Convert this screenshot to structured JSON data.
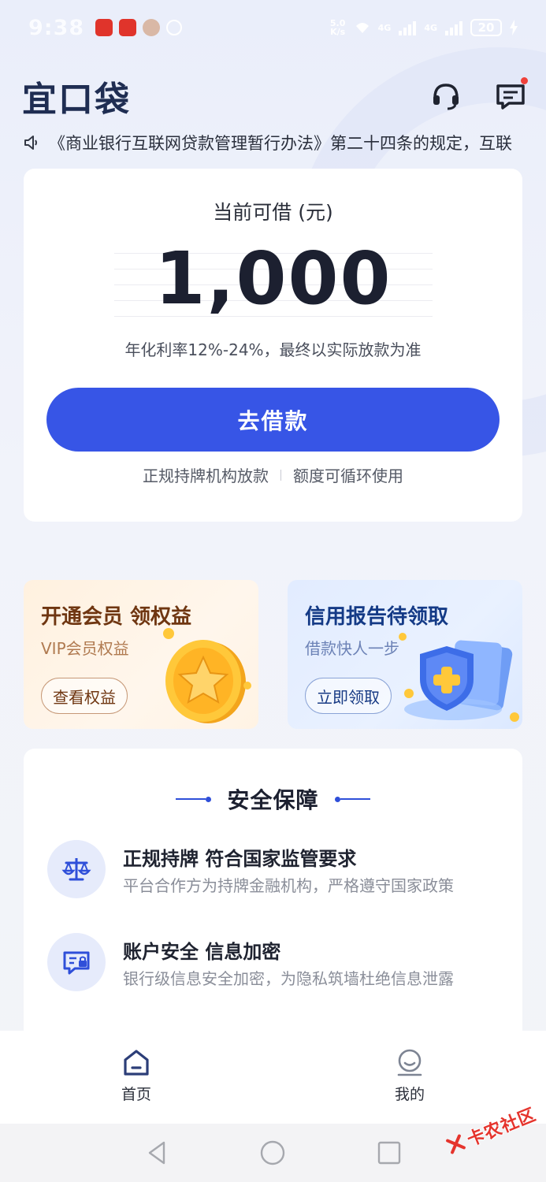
{
  "status_bar": {
    "time": "9:38",
    "network_speed": "5.0\nK/s",
    "signal_1": "4G",
    "signal_2": "4G",
    "battery": "20"
  },
  "header": {
    "logo": "宜口袋",
    "support_icon": "headset-icon",
    "message_icon": "message-icon"
  },
  "notice": {
    "icon": "speaker-icon",
    "text": "《商业银行互联网贷款管理暂行办法》第二十四条的规定，互联"
  },
  "loan_card": {
    "label": "当前可借 (元)",
    "amount": "1,000",
    "rate_text": "年化利率12%-24%，最终以实际放款为准",
    "button": "去借款",
    "feature_1": "正规持牌机构放款",
    "feature_2": "额度可循环使用"
  },
  "promos": [
    {
      "title": "开通会员 领权益",
      "subtitle": "VIP会员权益",
      "button": "查看权益",
      "art": "gold-star-coin-icon"
    },
    {
      "title": "信用报告待领取",
      "subtitle": "借款快人一步",
      "button": "立即领取",
      "art": "shield-report-icon"
    }
  ],
  "security": {
    "title": "安全保障",
    "items": [
      {
        "icon": "scale-icon",
        "title": "正规持牌 符合国家监管要求",
        "desc": "平台合作方为持牌金融机构，严格遵守国家政策"
      },
      {
        "icon": "secure-card-icon",
        "title": "账户安全 信息加密",
        "desc": "银行级信息安全加密，为隐私筑墙杜绝信息泄露"
      }
    ]
  },
  "bottom_nav": {
    "home": "首页",
    "mine": "我的"
  },
  "watermark": "卡农社区",
  "colors": {
    "primary": "#3755e6",
    "logo": "#1f2d52",
    "vip_title": "#6f3611",
    "credit_title": "#143a86",
    "alert": "#f0413a"
  }
}
